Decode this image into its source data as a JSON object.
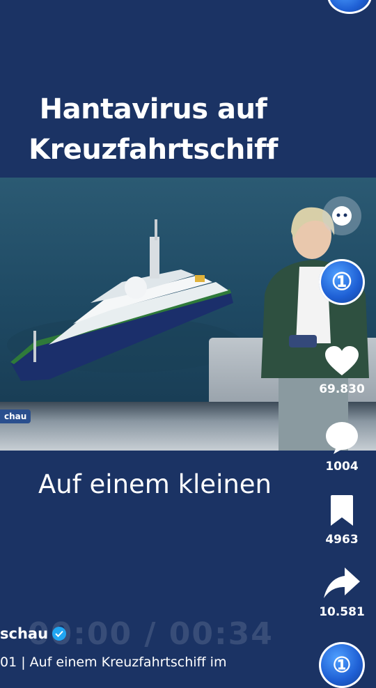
{
  "headline": {
    "line1": "Hantavirus auf",
    "line2": "Kreuzfahrtschiff"
  },
  "video": {
    "channel_tag": "chau",
    "caption": "Auf einem kleinen",
    "time_overlay": "00:00  /  00:34"
  },
  "actions": {
    "likes": "69.830",
    "comments": "1004",
    "saves": "4963",
    "shares": "10.581"
  },
  "account": {
    "name": "schau",
    "description": "01 | Auf einem Kreuzfahrtschiff im"
  },
  "icons": {
    "like": "heart-icon",
    "comment": "comment-bubble-icon",
    "save": "bookmark-icon",
    "share": "share-arrow-icon",
    "verified": "verified-check-icon",
    "ai": "assistant-face-icon"
  },
  "colors": {
    "background": "#1b3364",
    "brand_blue": "#1e5fd4",
    "verified": "#20a5f2"
  }
}
